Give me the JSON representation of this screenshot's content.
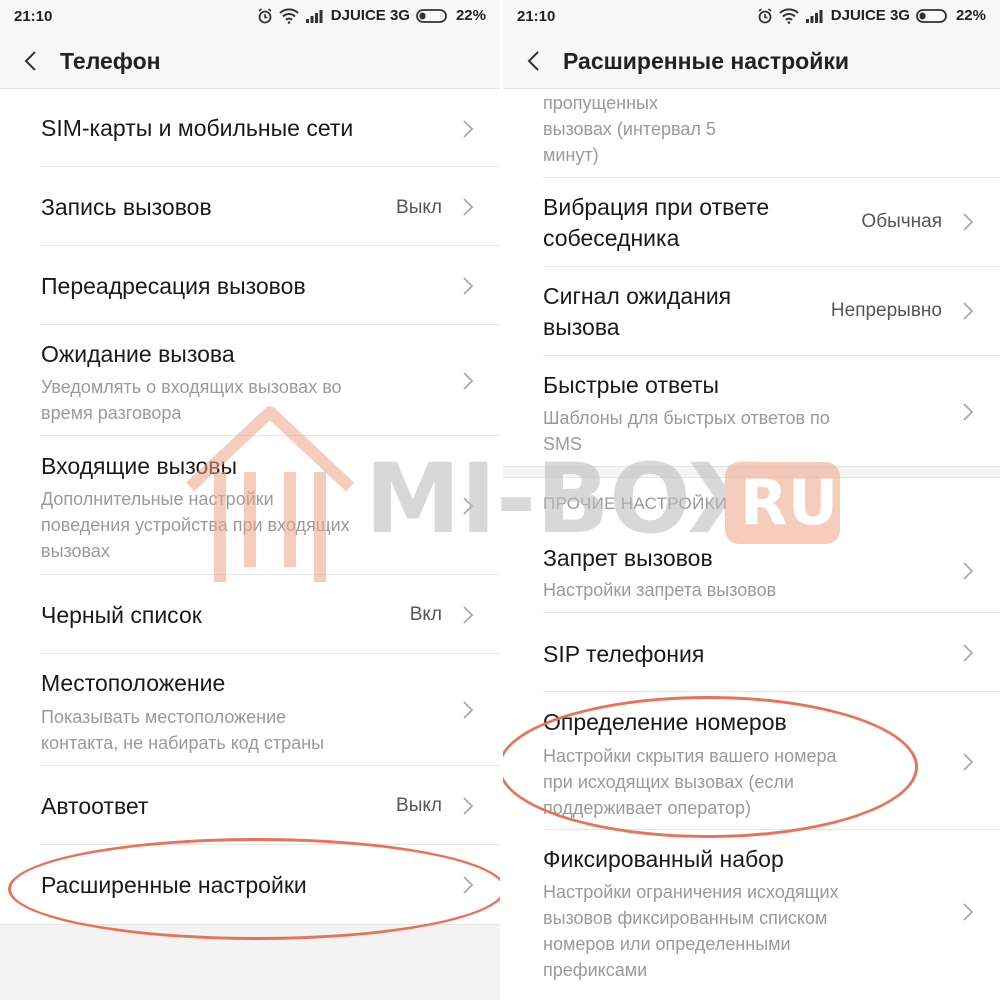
{
  "status": {
    "time": "21:10",
    "carrier": "DJUICE 3G",
    "battery": "22%"
  },
  "left": {
    "title": "Телефон",
    "items": [
      {
        "title": "SIM-карты и мобильные сети"
      },
      {
        "title": "Запись вызовов",
        "value": "Выкл"
      },
      {
        "title": "Переадресация вызовов"
      },
      {
        "title": "Ожидание вызова",
        "sub1": "Уведомлять о входящих вызовах во",
        "sub2": "время разговора"
      },
      {
        "title": "Входящие вызовы",
        "sub1": "Дополнительные настройки",
        "sub2": "поведения устройства при входящих",
        "sub3": "вызовах"
      },
      {
        "title": "Черный список",
        "value": "Вкл"
      },
      {
        "title": "Местоположение",
        "sub1": "Показывать местоположение",
        "sub2": "контакта, не набирать код страны"
      },
      {
        "title": "Автоответ",
        "value": "Выкл"
      },
      {
        "title": "Расширенные настройки"
      }
    ]
  },
  "right": {
    "title": "Расширенные настройки",
    "partial_sub1": "пропущенных",
    "partial_sub2": "вызовах (интервал 5",
    "partial_sub3": "минут)",
    "items": [
      {
        "title1": "Вибрация при ответе",
        "title2": "собеседника",
        "value": "Обычная"
      },
      {
        "title1": "Сигнал ожидания",
        "title2": "вызова",
        "value": "Непрерывно"
      },
      {
        "title": "Быстрые ответы",
        "sub1": "Шаблоны для быстрых ответов по",
        "sub2": "SMS"
      }
    ],
    "section_other": "ПРОЧИЕ НАСТРОЙКИ",
    "other_items": [
      {
        "title": "Запрет вызовов",
        "sub1": "Настройки запрета вызовов"
      },
      {
        "title": "SIP телефония"
      },
      {
        "title": "Определение номеров",
        "sub1": "Настройки скрытия вашего номера",
        "sub2": "при исходящих вызовах (если",
        "sub3": "поддерживает оператор)"
      },
      {
        "title": "Фиксированный набор",
        "sub1": "Настройки ограничения исходящих",
        "sub2": "вызовов фиксированным списком",
        "sub3": "номеров или определенными",
        "sub4": "префиксами"
      }
    ]
  },
  "watermark": {
    "text1": "MI-BOX",
    "text2": "RU"
  },
  "colors": {
    "highlight": "#e8725a",
    "watermark": "#f0a587"
  }
}
